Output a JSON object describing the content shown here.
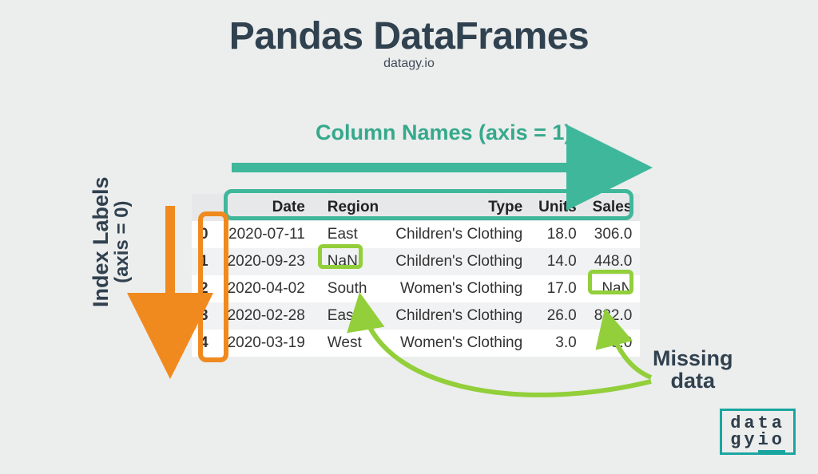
{
  "title": "Pandas DataFrames",
  "subtitle": "datagy.io",
  "labels": {
    "columns": "Column Names (axis = 1)",
    "index_line1": "Index Labels",
    "index_line2": "(axis = 0)",
    "missing_line1": "Missing",
    "missing_line2": "data"
  },
  "table": {
    "columns": [
      "Date",
      "Region",
      "Type",
      "Units",
      "Sales"
    ],
    "index": [
      "0",
      "1",
      "2",
      "3",
      "4"
    ],
    "rows": [
      {
        "Date": "2020-07-11",
        "Region": "East",
        "Type": "Children's Clothing",
        "Units": "18.0",
        "Sales": "306.0"
      },
      {
        "Date": "2020-09-23",
        "Region": "NaN",
        "Type": "Children's Clothing",
        "Units": "14.0",
        "Sales": "448.0"
      },
      {
        "Date": "2020-04-02",
        "Region": "South",
        "Type": "Women's Clothing",
        "Units": "17.0",
        "Sales": "NaN"
      },
      {
        "Date": "2020-02-28",
        "Region": "East",
        "Type": "Children's Clothing",
        "Units": "26.0",
        "Sales": "832.0"
      },
      {
        "Date": "2020-03-19",
        "Region": "West",
        "Type": "Women's Clothing",
        "Units": "3.0",
        "Sales": "33.0"
      }
    ]
  },
  "logo": {
    "line1": "data",
    "line2a": "gy",
    "line2b": "io"
  },
  "colors": {
    "teal": "#3fb79b",
    "orange": "#f08a1f",
    "green": "#92cf3a",
    "ink": "#30414f"
  }
}
